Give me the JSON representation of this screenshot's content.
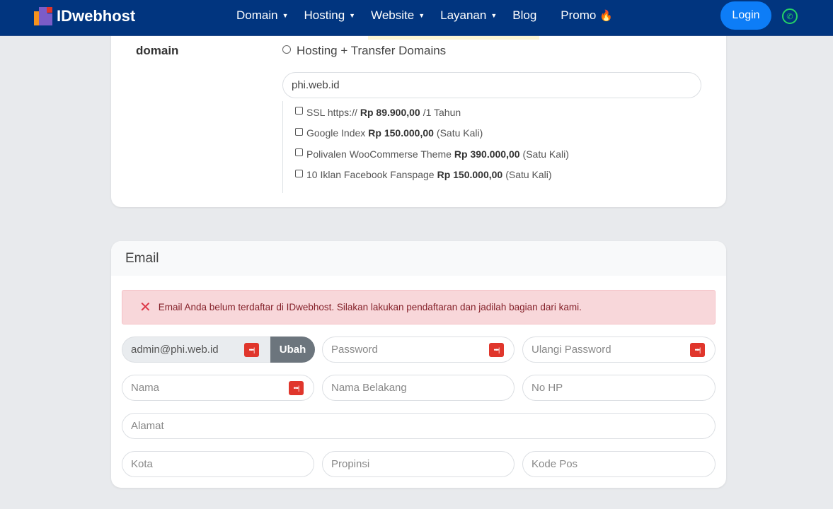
{
  "nav": {
    "brand": "IDwebhost",
    "items": [
      {
        "label": "Domain",
        "dropdown": true
      },
      {
        "label": "Hosting",
        "dropdown": true
      },
      {
        "label": "Website",
        "dropdown": true
      },
      {
        "label": "Layanan",
        "dropdown": true
      },
      {
        "label": "Blog",
        "dropdown": false
      },
      {
        "label": "Promo",
        "dropdown": false,
        "icon": "fire-icon"
      }
    ],
    "login_label": "Login",
    "colors": {
      "navbar": "#01357f",
      "login": "#0d7df7"
    }
  },
  "domain_section": {
    "label": "domain",
    "radio_option": "Hosting + Transfer Domains",
    "domain_value": "phi.web.id",
    "addons": [
      {
        "name": "SSL https://",
        "price": "Rp 89.900,00",
        "suffix": "/1 Tahun"
      },
      {
        "name": "Google Index",
        "price": "Rp 150.000,00",
        "suffix": "(Satu Kali)"
      },
      {
        "name": "Polivalen WooCommerse Theme",
        "price": "Rp 390.000,00",
        "suffix": "(Satu Kali)"
      },
      {
        "name": "10 Iklan Facebook Fanspage",
        "price": "Rp 150.000,00",
        "suffix": "(Satu Kali)"
      }
    ]
  },
  "email_section": {
    "title": "Email",
    "alert": "Email Anda belum terdaftar di IDwebhost. Silakan lakukan pendaftaran dan jadilah bagian dari kami.",
    "email_value": "admin@phi.web.id",
    "change_label": "Ubah",
    "placeholders": {
      "password": "Password",
      "repeat_password": "Ulangi Password",
      "first_name": "Nama",
      "last_name": "Nama Belakang",
      "phone": "No HP",
      "address": "Alamat",
      "city": "Kota",
      "province": "Propinsi",
      "postal_code": "Kode Pos"
    }
  }
}
